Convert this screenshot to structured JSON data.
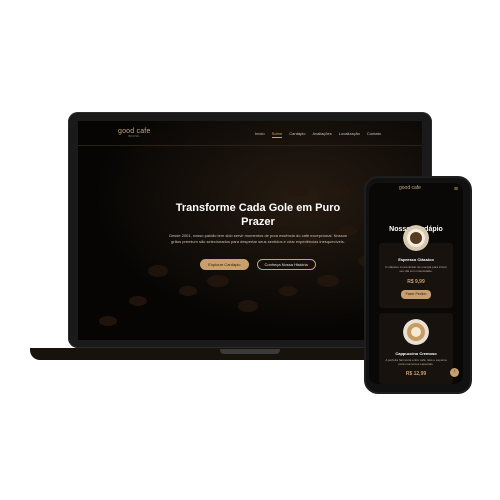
{
  "laptop": {
    "logo": "good cafe",
    "logo_sub": "BRASIL",
    "nav": [
      "Início",
      "Sobre",
      "Cardápio",
      "Avaliações",
      "Localização",
      "Contato"
    ],
    "active_nav": "Sobre",
    "hero": {
      "title": "Transforme Cada Gole em Puro Prazer",
      "description": "Desde 2001, nosso paixão tem sido servir momentos de pura essência do café excepcional. Nossos grãos premium são selecionados para despertar seus sentidos e criar experiências inesquecíveis.",
      "primary_button": "Explorar Cardápio",
      "secondary_button": "Conheça Nossa História"
    }
  },
  "phone": {
    "logo": "good cafe",
    "section_title": "Nosso Cardápio",
    "items": [
      {
        "name": "Espresso Clássico",
        "description": "O clássico concentrado de energia para iniciar seu dia com intensidade.",
        "price": "R$ 9,99",
        "button": "Fazer Pedido"
      },
      {
        "name": "Cappuccino Cremoso",
        "description": "A perfeita harmonia entre café, leite e espuma para momentos especiais.",
        "price": "R$ 12,99"
      }
    ]
  },
  "colors": {
    "accent": "#c9a06d",
    "background": "#0b0907",
    "text": "#ffffff"
  }
}
